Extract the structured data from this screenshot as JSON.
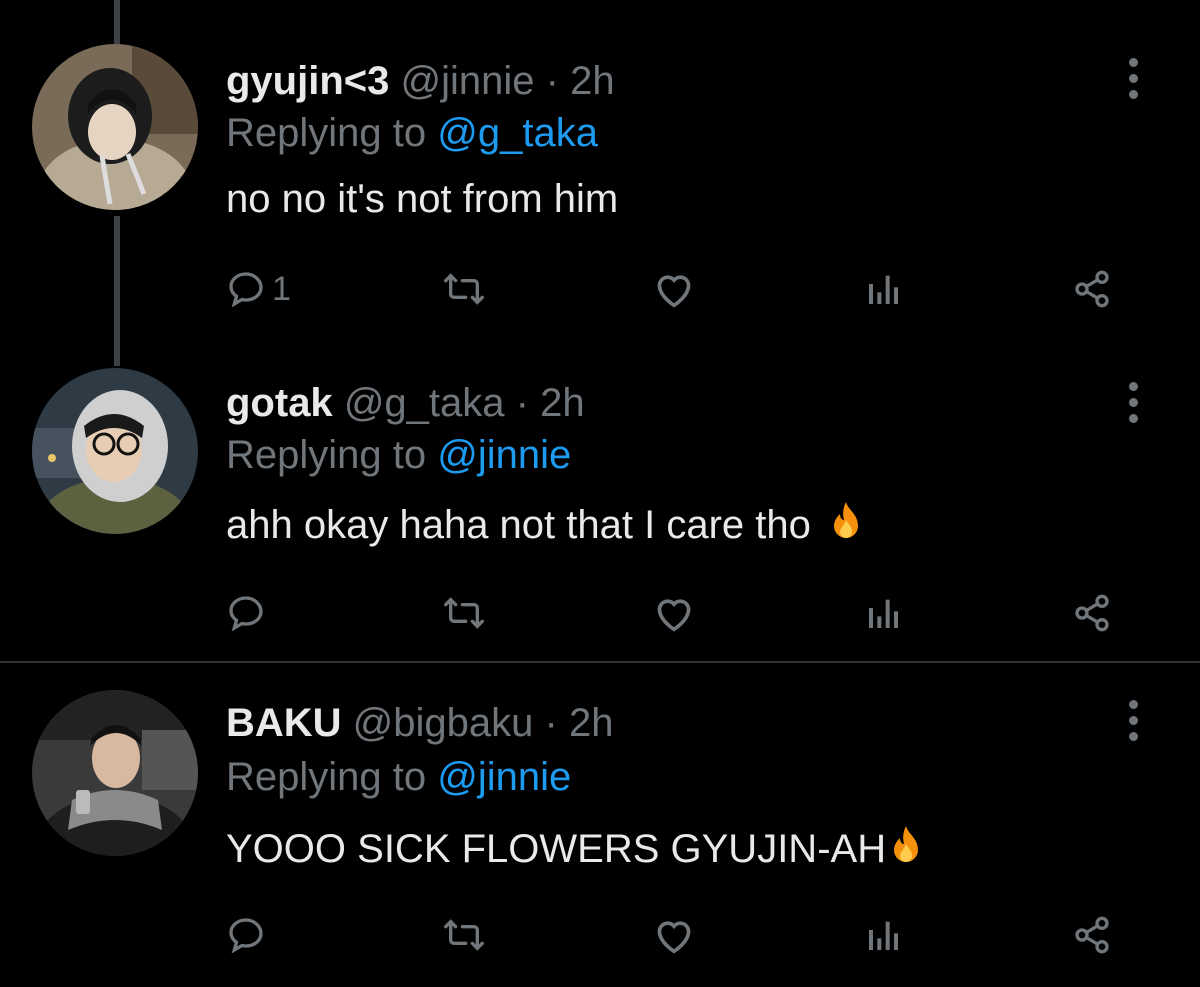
{
  "tweets": [
    {
      "name": "gyujin<3",
      "handle": "@jinnie",
      "separator": "·",
      "time": "2h",
      "replying_prefix": "Replying to",
      "replying_to": "@g_taka",
      "text": "no no it's not from him",
      "emoji": "",
      "reply_count": "1"
    },
    {
      "name": "gotak",
      "handle": "@g_taka",
      "separator": "·",
      "time": "2h",
      "replying_prefix": "Replying to",
      "replying_to": "@jinnie",
      "text": "ahh okay haha not that I care tho",
      "emoji": "fire-emoji",
      "reply_count": ""
    },
    {
      "name": "BAKU",
      "handle": "@bigbaku",
      "separator": "·",
      "time": "2h",
      "replying_prefix": "Replying to",
      "replying_to": "@jinnie",
      "text": "YOOO SICK FLOWERS GYUJIN-AH",
      "emoji": "fire-emoji",
      "reply_count": ""
    }
  ],
  "icons": {
    "reply": "speech-bubble-icon",
    "retweet": "retweet-icon",
    "like": "heart-icon",
    "views": "bar-chart-icon",
    "share": "share-icon",
    "more": "vertical-ellipsis-icon"
  },
  "colors": {
    "background": "#000000",
    "text": "#e7e9ea",
    "muted": "#71767b",
    "link": "#1d9bf0",
    "thread_line": "#3e4144",
    "divider": "#2f3336"
  }
}
